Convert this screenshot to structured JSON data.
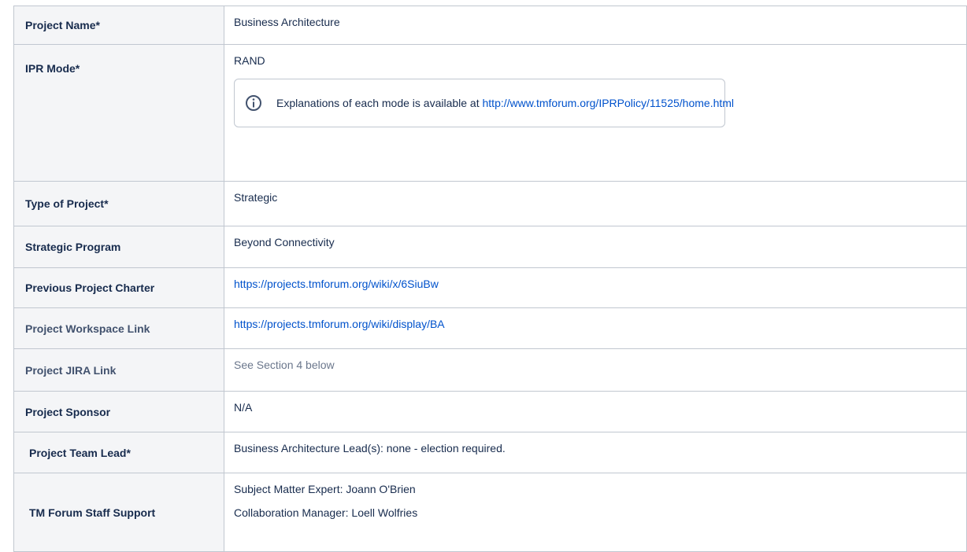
{
  "rows": {
    "project_name": {
      "label": "Project Name*",
      "value": "Business Architecture"
    },
    "ipr_mode": {
      "label": "IPR Mode*",
      "value": "RAND",
      "info_icon": "info-circle-icon",
      "info_text": "Explanations of each mode is available at ",
      "info_link": "http://www.tmforum.org/IPRPolicy/11525/home.html"
    },
    "type_of_project": {
      "label": "Type of Project*",
      "value": "Strategic"
    },
    "strategic_program": {
      "label": "Strategic Program",
      "value": "Beyond Connectivity"
    },
    "previous_charter": {
      "label": "Previous Project Charter",
      "value": "https://projects.tmforum.org/wiki/x/6SiuBw"
    },
    "workspace_link": {
      "label": "Project Workspace Link",
      "value": "https://projects.tmforum.org/wiki/display/BA"
    },
    "jira_link": {
      "label": "Project JIRA Link",
      "value": "See Section 4 below"
    },
    "sponsor": {
      "label": "Project Sponsor",
      "value": "N/A"
    },
    "team_lead": {
      "label": "Project Team Lead*",
      "value": "Business Architecture Lead(s): none - election required."
    },
    "staff_support": {
      "label": "TM Forum Staff Support",
      "values": [
        "Subject Matter Expert: Joann O'Brien",
        "Collaboration Manager: Loell Wolfries"
      ]
    }
  },
  "colors": {
    "link": "#0052cc",
    "border": "#c1c7d0",
    "label_bg": "#f4f5f7",
    "text": "#172b4d",
    "muted": "#6b778c"
  }
}
